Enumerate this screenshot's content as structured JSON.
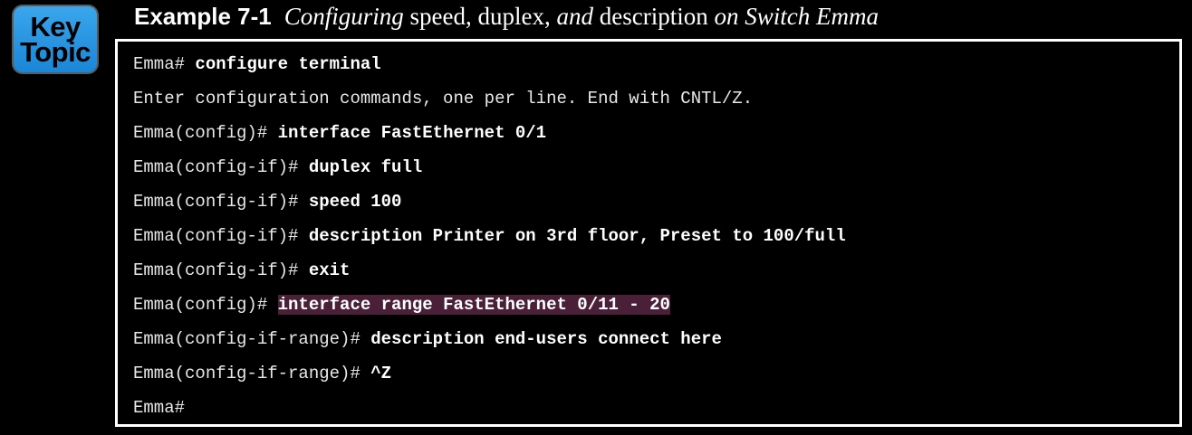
{
  "key_topic": {
    "line1": "Key",
    "line2": "Topic"
  },
  "title": {
    "label": "Example 7-1",
    "segments": [
      {
        "text": "Configuring ",
        "italic": true
      },
      {
        "text": "speed",
        "italic": false
      },
      {
        "text": ", ",
        "italic": false
      },
      {
        "text": "duplex",
        "italic": false
      },
      {
        "text": ", ",
        "italic": false
      },
      {
        "text": "and ",
        "italic": true
      },
      {
        "text": "description ",
        "italic": false
      },
      {
        "text": "on Switch Emma",
        "italic": true
      }
    ]
  },
  "console": {
    "lines": [
      {
        "prompt": "Emma# ",
        "command": "configure terminal",
        "highlight": false
      },
      {
        "prompt": "Enter configuration commands, one per line. End with CNTL/Z.",
        "command": "",
        "highlight": false
      },
      {
        "prompt": "Emma(config)# ",
        "command": "interface FastEthernet 0/1",
        "highlight": false
      },
      {
        "prompt": "Emma(config-if)# ",
        "command": "duplex full",
        "highlight": false
      },
      {
        "prompt": "Emma(config-if)# ",
        "command": "speed 100",
        "highlight": false
      },
      {
        "prompt": "Emma(config-if)# ",
        "command": "description Printer on 3rd floor, Preset to 100/full",
        "highlight": false
      },
      {
        "prompt": "Emma(config-if)# ",
        "command": "exit",
        "highlight": false
      },
      {
        "prompt": "Emma(config)# ",
        "command": "interface range FastEthernet 0/11 - 20",
        "highlight": true
      },
      {
        "prompt": "Emma(config-if-range)# ",
        "command": "description end-users connect here",
        "highlight": false
      },
      {
        "prompt": "Emma(config-if-range)# ",
        "command": "^Z",
        "highlight": false
      },
      {
        "prompt": "Emma#",
        "command": "",
        "highlight": false
      }
    ]
  }
}
